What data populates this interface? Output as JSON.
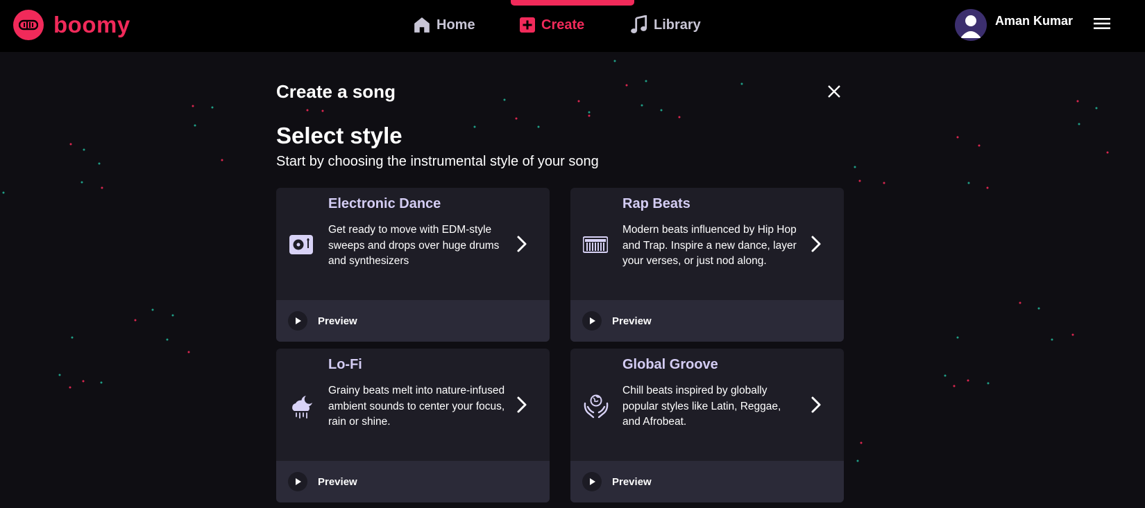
{
  "brand": {
    "name": "boomy",
    "accent": "#f12a5a"
  },
  "nav": {
    "items": [
      {
        "label": "Home",
        "icon": "home-icon",
        "active": false
      },
      {
        "label": "Create",
        "icon": "plus-square-icon",
        "active": true
      },
      {
        "label": "Library",
        "icon": "music-note-icon",
        "active": false
      }
    ]
  },
  "user": {
    "name": "Aman Kumar"
  },
  "panel": {
    "title": "Create a song",
    "step_title": "Select style",
    "step_subtitle": "Start by choosing the instrumental style of your song",
    "cards": [
      {
        "title": "Electronic Dance",
        "description": "Get ready to move with EDM-style sweeps and drops over huge drums and synthesizers",
        "icon": "turntable-icon",
        "preview_label": "Preview"
      },
      {
        "title": "Rap Beats",
        "description": "Modern beats influenced by Hip Hop and Trap. Inspire a new dance, layer your verses, or just nod along.",
        "icon": "keyboard-icon",
        "preview_label": "Preview"
      },
      {
        "title": "Lo-Fi",
        "description": "Grainy beats melt into nature-infused ambient sounds to center your focus, rain or shine.",
        "icon": "cloud-moon-rain-icon",
        "preview_label": "Preview"
      },
      {
        "title": "Global Groove",
        "description": "Chill beats inspired by globally popular styles like Latin, Reggae, and Afrobeat.",
        "icon": "globe-hands-icon",
        "preview_label": "Preview"
      }
    ]
  },
  "colors": {
    "topbar": "#000000",
    "background": "#0f0e13",
    "card": "#1e1d26",
    "card_footer": "#2b2a38",
    "card_title": "#d4cdf4",
    "icon": "#d8d2f6",
    "dot_red": "#d9264f",
    "dot_teal": "#1f9e86"
  }
}
